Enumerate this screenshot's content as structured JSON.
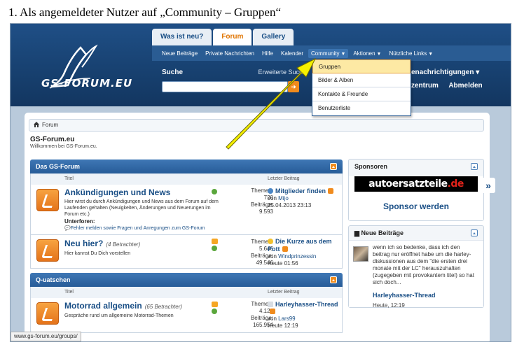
{
  "doc_heading": "1. Als angemeldeter Nutzer auf „Community – Gruppen“",
  "header": {
    "logo_text": "GS-FORUM.EU",
    "tabs": [
      "Was ist neu?",
      "Forum",
      "Gallery"
    ],
    "active_tab": "Forum",
    "nav": [
      "Neue Beiträge",
      "Private Nachrichten",
      "Hilfe",
      "Kalender",
      "Community",
      "Aktionen",
      "Nützliche Links"
    ],
    "search_label": "Suche",
    "search_advanced": "Erweiterte Suche",
    "account_notify": "enachrichtigungen ▾",
    "account_links": [
      "zentrum",
      "Abmelden"
    ]
  },
  "dropdown": {
    "items": [
      "Gruppen",
      "Bilder & Alben",
      "Kontakte & Freunde",
      "Benutzerliste"
    ],
    "highlighted": "Gruppen"
  },
  "breadcrumb": "Forum",
  "site": {
    "title": "GS-Forum.eu",
    "subtitle": "Willkommen bei GS-Forum.eu."
  },
  "categories": [
    {
      "name": "Das GS-Forum",
      "col_title": "Titel",
      "col_last": "Letzter Beitrag",
      "forums": [
        {
          "title": "Ankündigungen und News",
          "viewers": "",
          "desc": "Hier wirst du durch Ankündigungen und News aus dem Forum auf dem Laufenden gehalten (Neuigkeiten, Änderungen und Neuerungen im Forum etc.)",
          "sub_label": "Unterforen:",
          "sub_link": "Fehler melden sowie Fragen und Anregungen zum GS-Forum",
          "stats": [
            "Themen:",
            "720",
            "Beiträge:",
            "9.593"
          ],
          "last_title": "Mitglieder finden",
          "last_by": "von",
          "last_user": "Mijo",
          "last_date": "25.04.2013 23:13"
        },
        {
          "title": "Neu hier?",
          "viewers": "(4 Betrachter)",
          "desc": "Hier kannst Du Dich vorstellen",
          "stats": [
            "Themen:",
            "5.646",
            "Beiträge:",
            "49.546"
          ],
          "last_title": "Die Kurze aus dem Pott",
          "last_by": "von",
          "last_user": "Windprinzessin",
          "last_date": "Heute 01:56"
        }
      ]
    },
    {
      "name": "Q-uatschen",
      "col_title": "Titel",
      "col_last": "Letzter Beitrag",
      "forums": [
        {
          "title": "Motorrad allgemein",
          "viewers": "(65 Betrachter)",
          "desc": "Gespräche rund um allgemeine Motorrad-Themen",
          "stats": [
            "Themen:",
            "4.128",
            "Beiträge:",
            "165.954"
          ],
          "last_title": "Harleyhasser-Thread",
          "last_by": "von",
          "last_user": "Lars99",
          "last_date": "Heute 12:19"
        }
      ]
    }
  ],
  "sidebar": {
    "sponsors_title": "Sponsoren",
    "banner_main": "autoersatzteile",
    "banner_tld": ".de",
    "sponsor_link": "Sponsor werden",
    "new_posts_title": "Neue Beiträge",
    "post_text": "wenn ich so bedenke, dass ich den beitrag nur eröffnet habe um die harley-diskussionen aus dem \"die ersten drei monate mit der LC\" herauszuhalten (zugegeben mit provokantem titel) so hat sich doch...",
    "post_title": "Harleyhasser-Thread",
    "post_time": "Heute, 12:19",
    "toggle": "»"
  },
  "statusbar": "www.gs-forum.eu/groups/",
  "colors": {
    "header": "#17406f",
    "accent": "#f08b1d",
    "link": "#1a4f86",
    "annotation_arrow": "#f5f000"
  }
}
